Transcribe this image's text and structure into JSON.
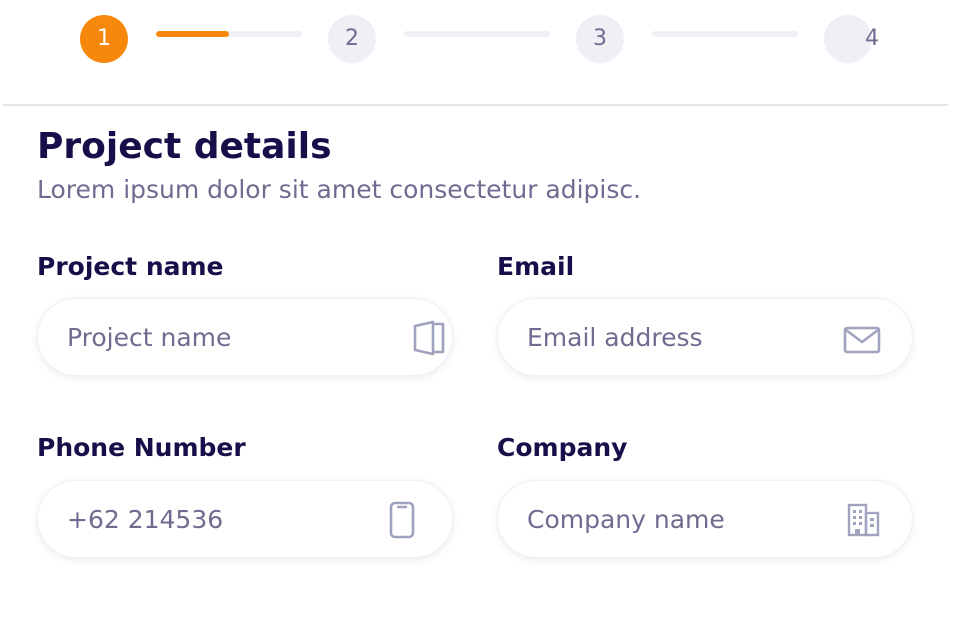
{
  "stepper": {
    "steps": [
      {
        "label": "1",
        "state": "active"
      },
      {
        "label": "2",
        "state": "inactive"
      },
      {
        "label": "3",
        "state": "inactive"
      },
      {
        "label": "4",
        "state": "inactive"
      }
    ],
    "connectors": [
      {
        "progress": 0.5
      },
      {
        "progress": 0
      },
      {
        "progress": 0
      }
    ]
  },
  "header": {
    "title": "Project details",
    "subtitle": "Lorem ipsum dolor sit amet consectetur adipisc."
  },
  "form": {
    "project_name": {
      "label": "Project name",
      "placeholder": "Project name",
      "value": "",
      "icon": "folder-icon"
    },
    "email": {
      "label": "Email",
      "placeholder": "Email address",
      "value": "",
      "icon": "mail-icon"
    },
    "phone": {
      "label": "Phone Number",
      "placeholder": "+62 214536",
      "value": "",
      "icon": "phone-icon"
    },
    "company": {
      "label": "Company",
      "placeholder": "Company name",
      "value": "",
      "icon": "building-icon"
    }
  },
  "colors": {
    "accent": "#f7880b",
    "heading": "#170f49",
    "muted": "#6f6c90",
    "track": "#eff0f6",
    "icon": "#a0a3bd"
  }
}
